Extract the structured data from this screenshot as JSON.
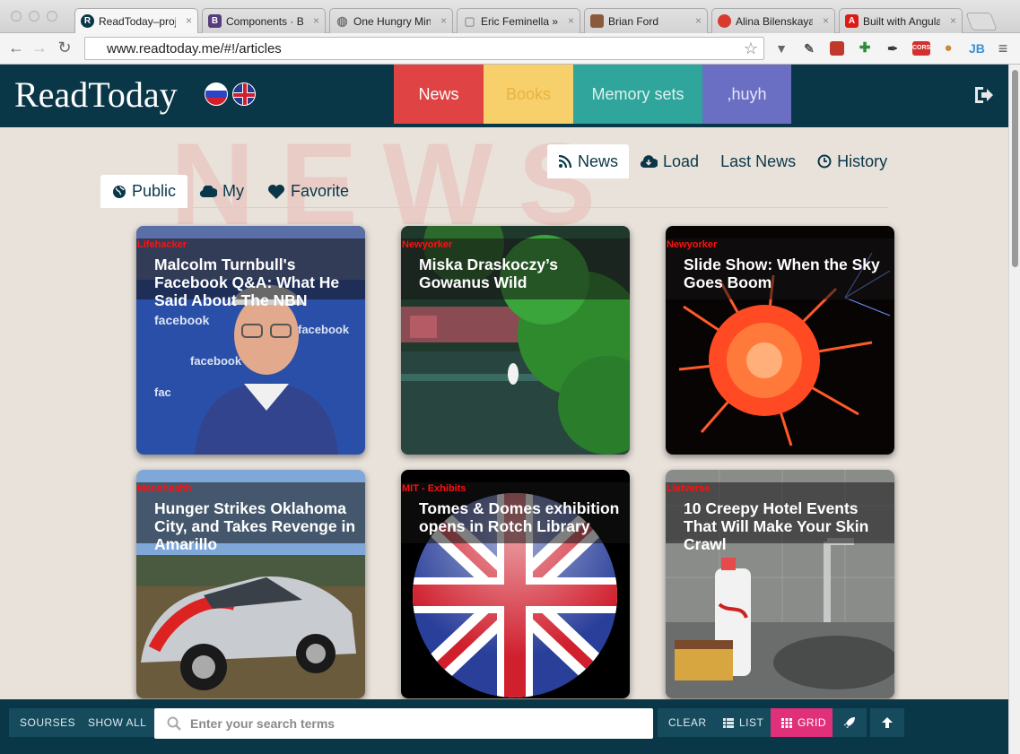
{
  "browser": {
    "tabs": [
      {
        "title": "ReadToday–proje",
        "favicon": "R",
        "favicon_color": "#0a3748",
        "active": true
      },
      {
        "title": "Components · Bo",
        "favicon": "B",
        "favicon_color": "#563d7c",
        "active": false
      },
      {
        "title": "One Hungry Mind",
        "favicon": "◍",
        "favicon_color": "#777777",
        "active": false
      },
      {
        "title": "Eric Feminella » T",
        "favicon": "▢",
        "favicon_color": "#999999",
        "active": false
      },
      {
        "title": "Brian Ford",
        "favicon": "●",
        "favicon_color": "#8b5a3c",
        "active": false
      },
      {
        "title": "Alina Bilenskaya",
        "favicon": "●",
        "favicon_color": "#d83a2e",
        "active": false
      },
      {
        "title": "Built with Angula",
        "favicon": "A",
        "favicon_color": "#dd1b16",
        "active": false
      }
    ],
    "tab_close_glyph": "×",
    "url": "www.readtoday.me/#!/articles",
    "back_glyph": "←",
    "forward_glyph": "→",
    "reload_glyph": "↻",
    "star_glyph": "☆",
    "extensions": [
      {
        "name": "pocket-icon",
        "glyph": "▼",
        "color": "#666666"
      },
      {
        "name": "tools-icon",
        "glyph": "✎",
        "color": "#555555"
      },
      {
        "name": "bookmark-ext-icon",
        "glyph": "▮",
        "color": "#c0392b"
      },
      {
        "name": "puzzle-icon",
        "glyph": "✚",
        "color": "#2e8b3a"
      },
      {
        "name": "eyedropper-icon",
        "glyph": "✒",
        "color": "#333333"
      },
      {
        "name": "cors-icon",
        "glyph": "CORS",
        "color": "#d32f2f"
      },
      {
        "name": "cookie-icon",
        "glyph": "●",
        "color": "#c98a3a"
      },
      {
        "name": "jb-icon",
        "glyph": "JB",
        "color": "#3a8fd8"
      },
      {
        "name": "menu-icon",
        "glyph": "≡",
        "color": "#555555"
      }
    ]
  },
  "header": {
    "logo": "ReadToday",
    "nav": [
      {
        "label": "News",
        "bg": "#e04343",
        "color": "#ffffff"
      },
      {
        "label": "Books",
        "bg": "#f7cf6b",
        "color": "#e8b440"
      },
      {
        "label": "Memory sets",
        "bg": "#2fa59b",
        "color": "#dff1ee"
      },
      {
        "label": ",huyh",
        "bg": "#6a6fc4",
        "color": "#e5e6f6"
      }
    ]
  },
  "watermark": "NEWS",
  "subnav": [
    {
      "label": "News",
      "icon": "rss-icon",
      "active": true
    },
    {
      "label": "Load",
      "icon": "cloud-download-icon",
      "active": false
    },
    {
      "label": "Last News",
      "icon": "",
      "active": false
    },
    {
      "label": "History",
      "icon": "clock-icon",
      "active": false
    }
  ],
  "scopenav": [
    {
      "label": "Public",
      "icon": "globe-icon",
      "active": true
    },
    {
      "label": "My",
      "icon": "cloud-icon",
      "active": false
    },
    {
      "label": "Favorite",
      "icon": "heart-icon",
      "active": false
    }
  ],
  "articles": [
    {
      "source": "Lifehacker",
      "title": "Malcolm Turnbull's Facebook Q&A: What He Said About The NBN",
      "image": "man-at-facebook-event"
    },
    {
      "source": "Newyorker",
      "title": "Miska Draskoczy’s Gowanus Wild",
      "image": "canal-with-egret"
    },
    {
      "source": "Newyorker",
      "title": "Slide Show: When the Sky Goes Boom",
      "image": "red-firework"
    },
    {
      "source": "Menshealth",
      "title": "Hunger Strikes Oklahoma City, and Takes Revenge in Amarillo",
      "image": "rally-car"
    },
    {
      "source": "MIT - Exhibits",
      "title": "Tomes & Domes exhibition opens in Rotch Library",
      "image": "uk-flag-orb"
    },
    {
      "source": "Listverse",
      "title": "10 Creepy Hotel Events That Will Make Your Skin Crawl",
      "image": "bloody-sink"
    }
  ],
  "footer": {
    "sources": "SOURSES",
    "show_all": "SHOW ALL",
    "search_placeholder": "Enter your search terms",
    "clear": "CLEAR",
    "list": "LIST",
    "grid": "GRID"
  }
}
